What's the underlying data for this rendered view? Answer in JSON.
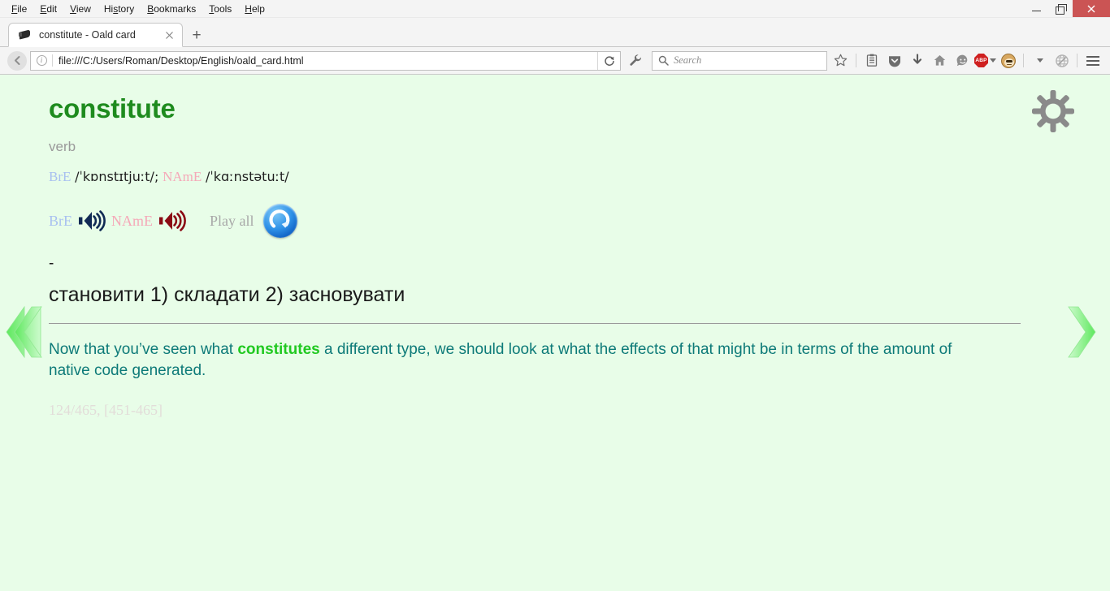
{
  "window": {
    "menus": [
      "File",
      "Edit",
      "View",
      "History",
      "Bookmarks",
      "Tools",
      "Help"
    ],
    "minimize_label": "–",
    "restore_label": "❐",
    "close_label": "✕"
  },
  "tabs": {
    "active": {
      "title": "constitute - Oald card",
      "favicon": "bookmark-dark-icon",
      "close_label": "✕"
    },
    "new_tab_label": "+"
  },
  "navbar": {
    "back_label": "‹",
    "url": "file:///C:/Users/Roman/Desktop/English/oald_card.html",
    "info_glyph": "i",
    "reload_label": "⟳",
    "search_placeholder": "Search",
    "icons": [
      {
        "name": "wrench-icon",
        "glyph": "🔧"
      },
      {
        "name": "bookmark-star-icon",
        "glyph": "☆"
      },
      {
        "name": "reader-list-icon",
        "glyph": "▤"
      },
      {
        "name": "pocket-icon",
        "glyph": "⌄"
      },
      {
        "name": "download-icon",
        "glyph": "⬇"
      },
      {
        "name": "home-icon",
        "glyph": "⌂"
      },
      {
        "name": "chat-smiley-icon",
        "glyph": "☺"
      },
      {
        "name": "adblock-plus-icon",
        "glyph": "ABP"
      },
      {
        "name": "greasemonkey-icon",
        "glyph": "🐵"
      },
      {
        "name": "globe-pencil-icon",
        "glyph": "🌐"
      },
      {
        "name": "menu-hamburger-icon",
        "glyph": "☰"
      }
    ]
  },
  "card": {
    "headword": "constitute",
    "part_of_speech": "verb",
    "phonetics": {
      "bre_label": "BrE",
      "bre_ipa": "/ˈkɒnstɪtjuːt/;",
      "name_label": "NAmE",
      "name_ipa": "/ˈkɑːnstətuːt/"
    },
    "audio": {
      "bre_label": "BrE",
      "name_label": "NAmE",
      "play_all_label": "Play all",
      "replay_name": "replay-button"
    },
    "dash": "-",
    "translation": "становити 1) складати 2) засновувати",
    "example": {
      "before": "Now that you’ve seen what ",
      "highlight": "constitutes",
      "after": " a different type, we should look at what the effects of that might be in terms of the amount of native code generated."
    },
    "counter": "124/465, [451-465]",
    "settings_name": "settings-gear-button",
    "prev_name": "previous-card-arrow",
    "next_name": "next-card-arrow"
  },
  "colors": {
    "page_bg": "#e8fde8",
    "headword": "#1e8b1e",
    "example_text": "#0d7a78",
    "highlight": "#21c921",
    "bre": "#a8c0f0",
    "name": "#f5a8b8",
    "counter": "#e2ddd9"
  }
}
